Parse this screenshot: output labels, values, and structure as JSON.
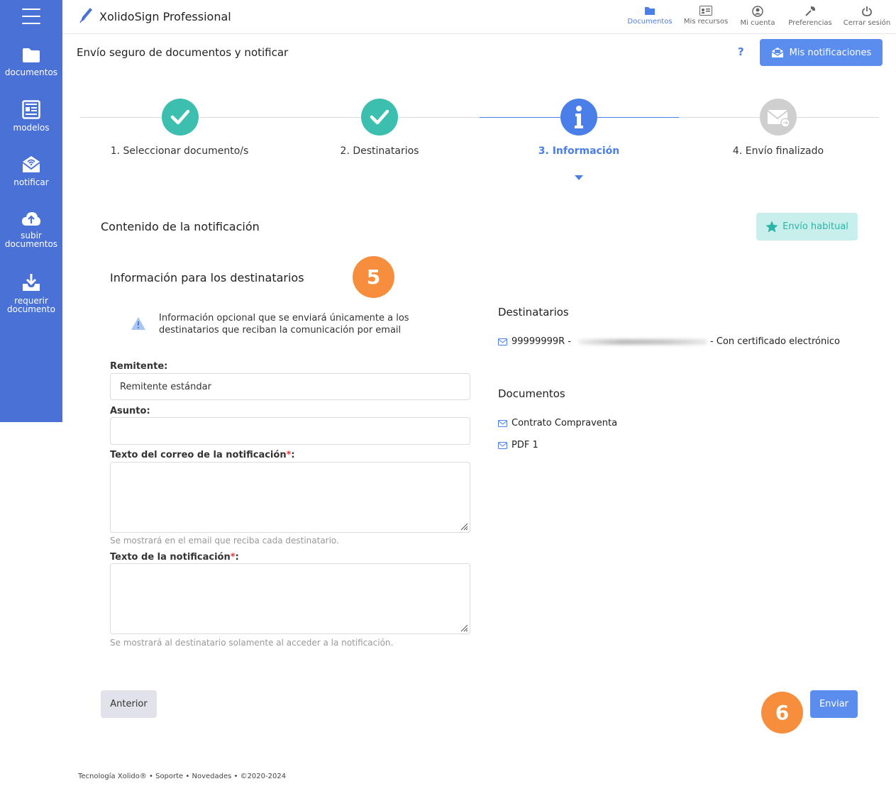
{
  "app": {
    "name": "XolidoSign Professional"
  },
  "sidebar": {
    "items": [
      {
        "label": "documentos",
        "icon": "folder-icon"
      },
      {
        "label": "modelos",
        "icon": "template-icon"
      },
      {
        "label": "notificar",
        "icon": "envelope-notify-icon"
      },
      {
        "label": "subir documentos",
        "icon": "cloud-upload-icon"
      },
      {
        "label": "requerir documento",
        "icon": "download-tray-icon"
      }
    ]
  },
  "topnav": [
    {
      "label": "Documentos",
      "icon": "folder-icon",
      "active": true
    },
    {
      "label": "Mis recursos",
      "icon": "id-card-icon",
      "active": false
    },
    {
      "label": "Mi cuenta",
      "icon": "user-icon",
      "active": false
    },
    {
      "label": "Preferencias",
      "icon": "wrench-icon",
      "active": false
    },
    {
      "label": "Cerrar sesión",
      "icon": "power-icon",
      "active": false
    }
  ],
  "header": {
    "title": "Envío seguro de documentos y notificar",
    "help": "?",
    "notifications_button": "Mis notificaciones"
  },
  "stepper": {
    "steps": [
      {
        "label": "1. Seleccionar documento/s",
        "state": "done"
      },
      {
        "label": "2. Destinatarios",
        "state": "done"
      },
      {
        "label": "3. Información",
        "state": "active"
      },
      {
        "label": "4. Envío finalizado",
        "state": "pending"
      }
    ]
  },
  "content": {
    "section_title": "Contenido de la notificación",
    "habitual_button": "Envío habitual",
    "subtitle": "Información para los destinatarios",
    "info_text": "Información opcional que se enviará únicamente a los destinatarios que reciban la comunicación por email",
    "remitente": {
      "label": "Remitente:",
      "value": "Remitente estándar"
    },
    "asunto": {
      "label": "Asunto:",
      "value": ""
    },
    "texto_correo": {
      "label": "Texto del correo de la notificación",
      "required": "*",
      "suffix": ":",
      "hint": "Se mostrará en el email que reciba cada destinatario."
    },
    "texto_notificacion": {
      "label": "Texto de la notificación",
      "required": "*",
      "suffix": ":",
      "hint": "Se mostrará al destinatario solamente al acceder a la notificación."
    }
  },
  "recipients": {
    "title": "Destinatarios",
    "items": [
      {
        "id": "99999999R -",
        "suffix": "- Con certificado electrónico"
      }
    ]
  },
  "documents": {
    "title": "Documentos",
    "items": [
      "Contrato Compraventa",
      "PDF 1"
    ]
  },
  "badges": {
    "five": "5",
    "six": "6"
  },
  "actions": {
    "prev": "Anterior",
    "send": "Enviar"
  },
  "footer": {
    "text": "Tecnología Xolido® • Soporte • Novedades • ©2020-2024"
  },
  "colors": {
    "sidebar": "#4a72d6",
    "primary": "#5b8def",
    "done": "#3cbfae",
    "badge": "#f78e3d",
    "pending": "#cfcfcf"
  }
}
